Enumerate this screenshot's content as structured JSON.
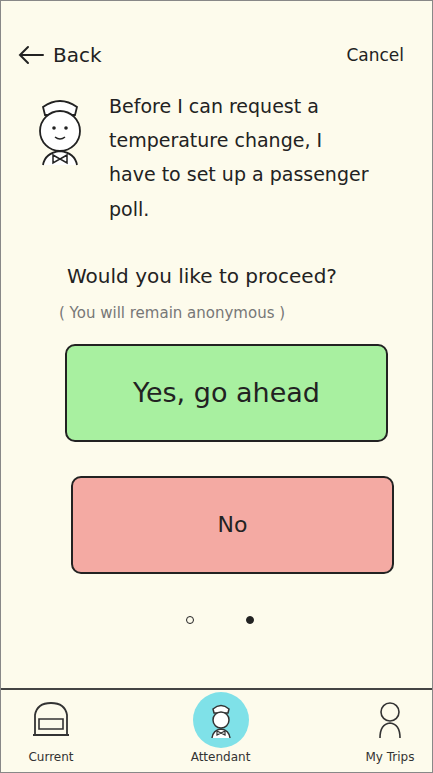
{
  "header": {
    "back": "Back",
    "cancel": "Cancel"
  },
  "message": "Before I can request a temperature change, I have to set up a passenger poll.",
  "question": "Would you like to proceed?",
  "note": "( You will remain anonymous )",
  "buttons": [
    {
      "label": "Yes, go ahead",
      "color": "#a8f0a0"
    },
    {
      "label": "No",
      "color": "#f4aaa3"
    }
  ],
  "pager": [
    {
      "selected": false
    },
    {
      "selected": true
    }
  ],
  "nav": [
    {
      "label": "Current",
      "selected": false
    },
    {
      "label": "Attendant",
      "selected": true
    },
    {
      "label": "My Trips",
      "selected": false
    }
  ]
}
